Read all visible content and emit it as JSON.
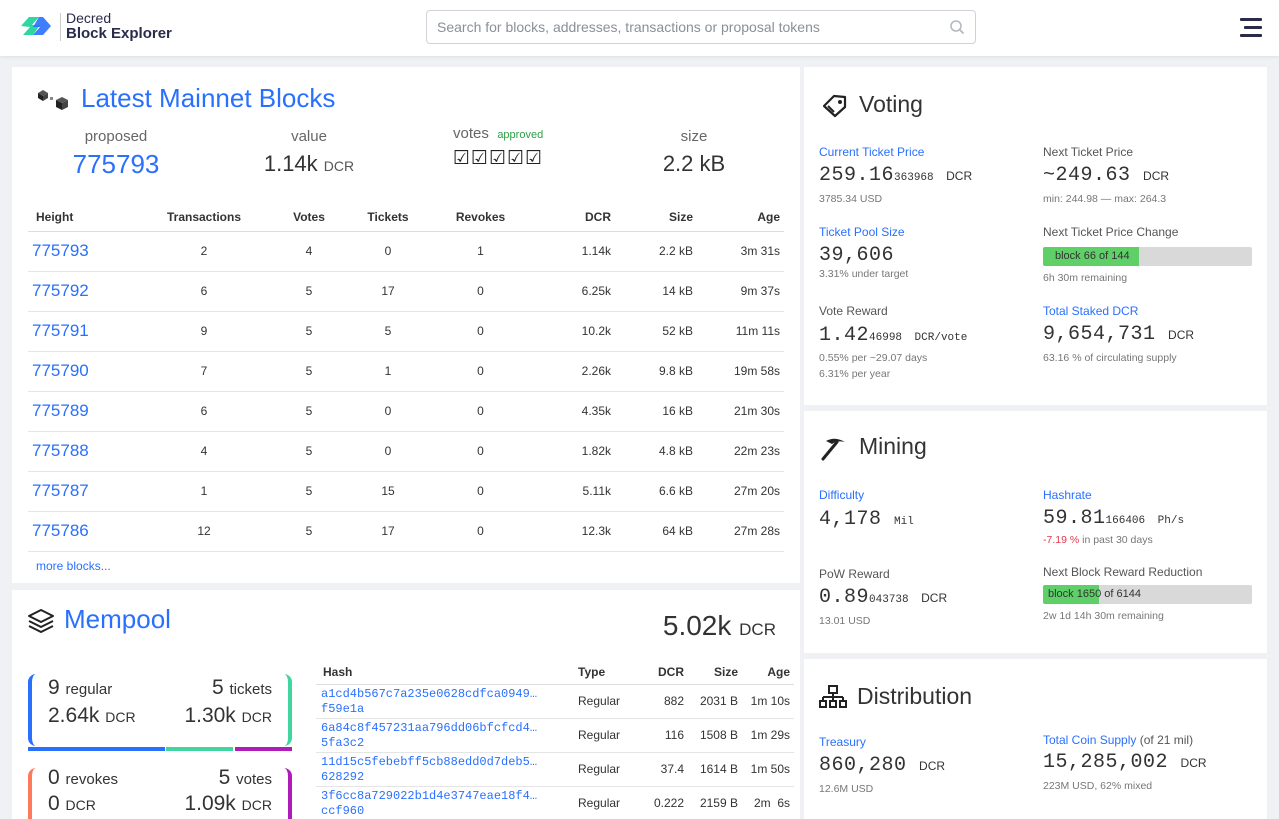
{
  "header": {
    "logo_line1": "Decred",
    "logo_line2": "Block Explorer",
    "search_placeholder": "Search for blocks, addresses, transactions or proposal tokens"
  },
  "blocks": {
    "title": "Latest Mainnet Blocks",
    "summary": {
      "proposed_label": "proposed",
      "proposed_value": "775793",
      "value_label": "value",
      "value_amount": "1.14k",
      "value_unit": "DCR",
      "votes_label": "votes",
      "votes_status": "approved",
      "votes_checks": "☑☑☑☑☑",
      "size_label": "size",
      "size_value": "2.2 kB"
    },
    "columns": [
      "Height",
      "Transactions",
      "Votes",
      "Tickets",
      "Revokes",
      "DCR",
      "Size",
      "Age"
    ],
    "rows": [
      [
        "775793",
        "2",
        "4",
        "0",
        "1",
        "1.14k",
        "2.2 kB",
        "3m 31s"
      ],
      [
        "775792",
        "6",
        "5",
        "17",
        "0",
        "6.25k",
        "14 kB",
        "9m 37s"
      ],
      [
        "775791",
        "9",
        "5",
        "5",
        "0",
        "10.2k",
        "52 kB",
        "11m 11s"
      ],
      [
        "775790",
        "7",
        "5",
        "1",
        "0",
        "2.26k",
        "9.8 kB",
        "19m 58s"
      ],
      [
        "775789",
        "6",
        "5",
        "0",
        "0",
        "4.35k",
        "16 kB",
        "21m 30s"
      ],
      [
        "775788",
        "4",
        "5",
        "0",
        "0",
        "1.82k",
        "4.8 kB",
        "22m 23s"
      ],
      [
        "775787",
        "1",
        "5",
        "15",
        "0",
        "5.11k",
        "6.6 kB",
        "27m 20s"
      ],
      [
        "775786",
        "12",
        "5",
        "17",
        "0",
        "12.3k",
        "64 kB",
        "27m 28s"
      ]
    ],
    "more_link": "more blocks..."
  },
  "mempool": {
    "title": "Mempool",
    "total_amount": "5.02k",
    "total_unit": "DCR",
    "regular_count": "9",
    "regular_label": "regular",
    "regular_amount": "2.64k",
    "tickets_count": "5",
    "tickets_label": "tickets",
    "tickets_amount": "1.30k",
    "revokes_count": "0",
    "revokes_label": "revokes",
    "revokes_amount": "0",
    "votes_count": "5",
    "votes_label": "votes",
    "votes_amount": "1.09k",
    "unit": "DCR",
    "colors": {
      "regular": "#2970ff",
      "tickets": "#41d69f",
      "votes": "#b01cb9",
      "revokes": "#ff7a5c"
    },
    "columns": [
      "Hash",
      "Type",
      "DCR",
      "Size",
      "Age"
    ],
    "rows": [
      [
        "a1cd4b567c7a235e0628cdfca0949…f59e1a",
        "Regular",
        "882",
        "2031 B",
        "1m 10s"
      ],
      [
        "6a84c8f457231aa796dd06bfcfcd4…5fa3c2",
        "Regular",
        "116",
        "1508 B",
        "1m 29s"
      ],
      [
        "11d15c5febebff5cb88edd0d7deb5…628292",
        "Regular",
        "37.4",
        "1614 B",
        "1m 50s"
      ],
      [
        "3f6cc8a729022b1d4e3747eae18f4…ccf960",
        "Regular",
        "0.222",
        "2159 B",
        "2m  6s"
      ]
    ]
  },
  "voting": {
    "title": "Voting",
    "current_ticket_price_label": "Current Ticket Price",
    "current_ticket_price_main": "259.16",
    "current_ticket_price_small": "363968",
    "current_ticket_price_unit": "DCR",
    "current_ticket_price_usd": "3785.34 USD",
    "next_ticket_price_label": "Next Ticket Price",
    "next_ticket_price_value": "~249.63",
    "next_ticket_price_unit": "DCR",
    "next_ticket_price_range": "min: 244.98 — max: 264.3",
    "ticket_pool_size_label": "Ticket Pool Size",
    "ticket_pool_size_value": "39,606",
    "ticket_pool_size_sub": "3.31% under target",
    "next_price_change_label": "Next Ticket Price Change",
    "next_price_change_bar": "block 66 of 144",
    "next_price_change_fraction": 0.458,
    "next_price_change_remaining": "6h 30m remaining",
    "vote_reward_label": "Vote Reward",
    "vote_reward_main": "1.42",
    "vote_reward_small": "46998",
    "vote_reward_unit": "DCR/vote",
    "vote_reward_sub1": "0.55% per ~29.07 days",
    "vote_reward_sub2": "6.31% per year",
    "total_staked_label": "Total Staked DCR",
    "total_staked_value": "9,654,731",
    "total_staked_unit": "DCR",
    "total_staked_sub": "63.16 % of circulating supply"
  },
  "mining": {
    "title": "Mining",
    "difficulty_label": "Difficulty",
    "difficulty_value": "4,178",
    "difficulty_unit": "Mil",
    "hashrate_label": "Hashrate",
    "hashrate_main": "59.81",
    "hashrate_small": "166406",
    "hashrate_unit": "Ph/s",
    "hashrate_change": "-7.19 %",
    "hashrate_change_suffix": "in past 30 days",
    "pow_reward_label": "PoW Reward",
    "pow_reward_main": "0.89",
    "pow_reward_small": "043738",
    "pow_reward_unit": "DCR",
    "pow_reward_usd": "13.01 USD",
    "reduction_label": "Next Block Reward Reduction",
    "reduction_bar": "block 1650 of 6144",
    "reduction_fraction": 0.2686,
    "reduction_remaining": "2w 1d 14h 30m remaining"
  },
  "distribution": {
    "title": "Distribution",
    "treasury_label": "Treasury",
    "treasury_value": "860,280",
    "treasury_unit": "DCR",
    "treasury_usd": "12.6M USD",
    "supply_label": "Total Coin Supply",
    "supply_suffix": "(of 21 mil)",
    "supply_value": "15,285,002",
    "supply_unit": "DCR",
    "supply_sub": "223M USD, 62% mixed"
  }
}
